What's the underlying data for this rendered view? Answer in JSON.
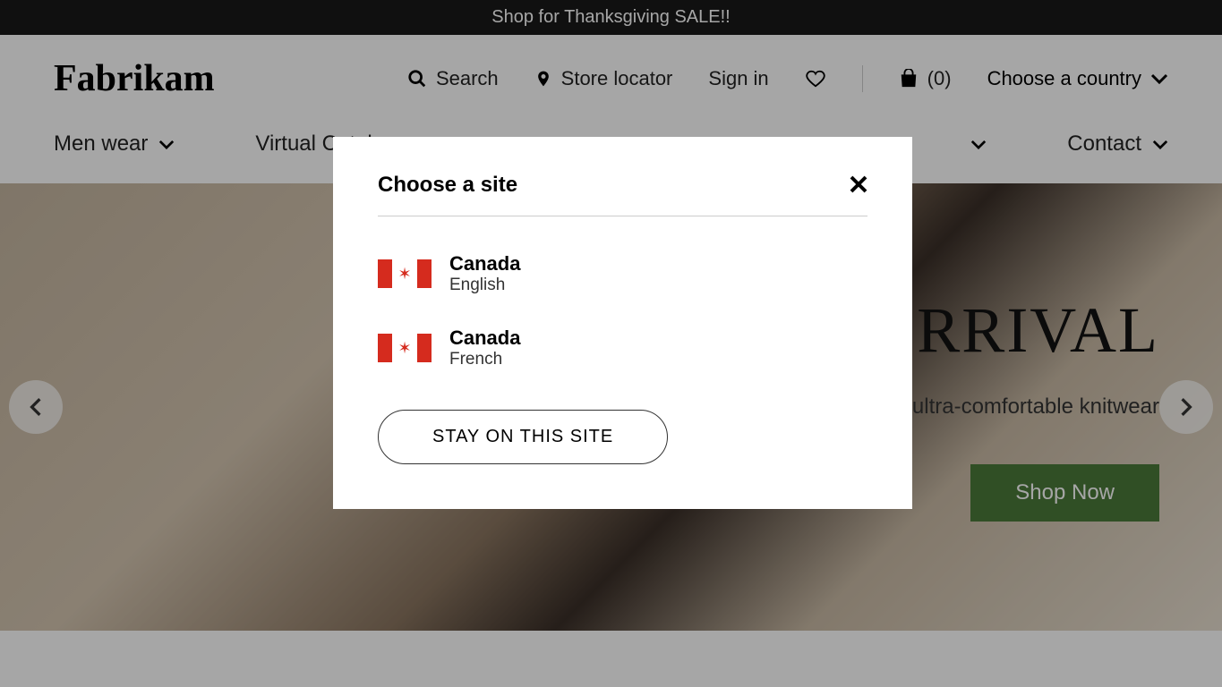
{
  "promo": {
    "text": "Shop for Thanksgiving SALE!!"
  },
  "logo": "Fabrikam",
  "header": {
    "search": "Search",
    "store_locator": "Store locator",
    "sign_in": "Sign in",
    "cart_count": "(0)",
    "country_label": "Choose a country"
  },
  "nav": {
    "men_wear": "Men wear",
    "virtual_catalog": "Virtual Catalog",
    "contact": "Contact"
  },
  "hero": {
    "title_fragment": "RRIVAL",
    "sub_fragment": "ultra-comfortable knitwear",
    "shop_now": "Shop Now"
  },
  "modal": {
    "title": "Choose a site",
    "sites": [
      {
        "country": "Canada",
        "language": "English"
      },
      {
        "country": "Canada",
        "language": "French"
      }
    ],
    "stay_button": "STAY ON THIS SITE"
  }
}
